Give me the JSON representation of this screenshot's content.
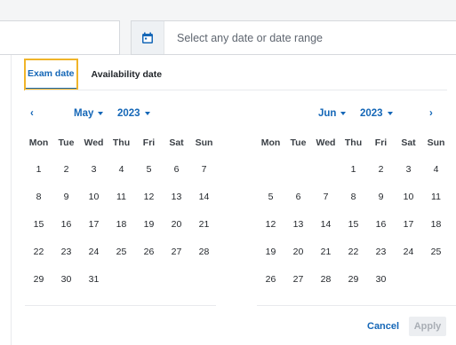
{
  "date_input": {
    "placeholder": "Select any date or date range",
    "icon": "calendar-icon"
  },
  "tabs": [
    {
      "label": "Exam date",
      "active": true
    },
    {
      "label": "Availability date",
      "active": false
    }
  ],
  "weekdays": [
    "Mon",
    "Tue",
    "Wed",
    "Thu",
    "Fri",
    "Sat",
    "Sun"
  ],
  "calendars": [
    {
      "month": "May",
      "year": "2023",
      "weeks": [
        [
          "1",
          "2",
          "3",
          "4",
          "5",
          "6",
          "7"
        ],
        [
          "8",
          "9",
          "10",
          "11",
          "12",
          "13",
          "14"
        ],
        [
          "15",
          "16",
          "17",
          "18",
          "19",
          "20",
          "21"
        ],
        [
          "22",
          "23",
          "24",
          "25",
          "26",
          "27",
          "28"
        ],
        [
          "29",
          "30",
          "31",
          "",
          "",
          "",
          ""
        ]
      ]
    },
    {
      "month": "Jun",
      "year": "2023",
      "weeks": [
        [
          "",
          "",
          "",
          "1",
          "2",
          "3",
          "4"
        ],
        [
          "5",
          "6",
          "7",
          "8",
          "9",
          "10",
          "11"
        ],
        [
          "12",
          "13",
          "14",
          "15",
          "16",
          "17",
          "18"
        ],
        [
          "19",
          "20",
          "21",
          "22",
          "23",
          "24",
          "25"
        ],
        [
          "26",
          "27",
          "28",
          "29",
          "30",
          "",
          ""
        ]
      ]
    }
  ],
  "nav": {
    "prev": "‹",
    "next": "›"
  },
  "footer": {
    "cancel": "Cancel",
    "apply": "Apply"
  },
  "colors": {
    "accent": "#1567b7",
    "focus": "#f0b429",
    "disabled_bg": "#eceef1",
    "disabled_text": "#a9aeb5"
  }
}
